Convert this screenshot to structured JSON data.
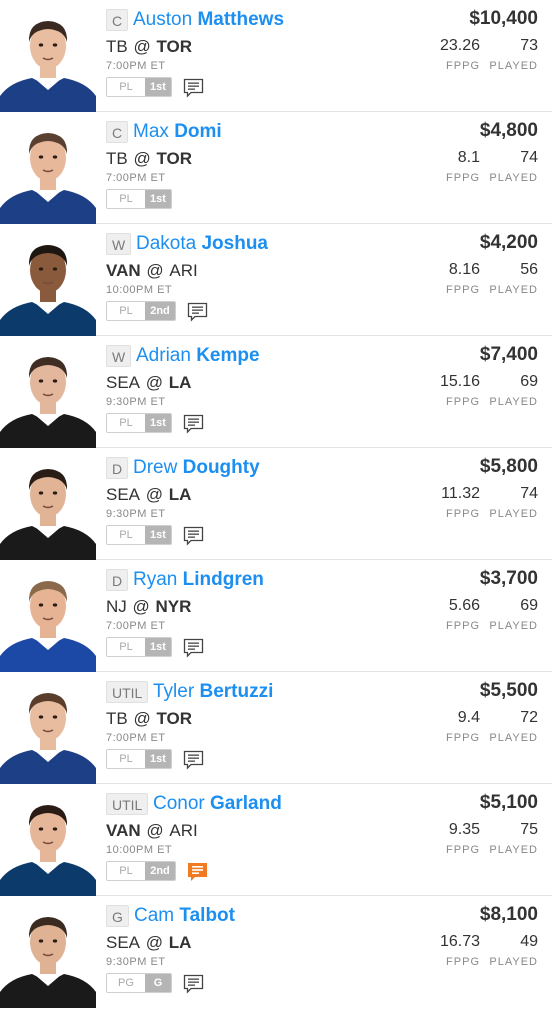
{
  "stat_labels": {
    "fppg": "FPPG",
    "played": "PLAYED"
  },
  "colors": {
    "accent": "#1c8ff0",
    "news_alert": "#f27b21"
  },
  "players": [
    {
      "position": "C",
      "first": "Auston",
      "last": "Matthews",
      "away": "TB",
      "home": "TOR",
      "bold_team": "home",
      "time": "7:00PM ET",
      "status_a": "PL",
      "status_b": "1st",
      "salary": "$10,400",
      "fppg": "23.26",
      "played": "73",
      "news": "normal",
      "jersey": "#1d3f86",
      "skin": "#e9bda0",
      "hair": "#3b2a22"
    },
    {
      "position": "C",
      "first": "Max",
      "last": "Domi",
      "away": "TB",
      "home": "TOR",
      "bold_team": "home",
      "time": "7:00PM ET",
      "status_a": "PL",
      "status_b": "1st",
      "salary": "$4,800",
      "fppg": "8.1",
      "played": "74",
      "news": "none",
      "jersey": "#1d3f86",
      "skin": "#e8b89b",
      "hair": "#5a4030"
    },
    {
      "position": "W",
      "first": "Dakota",
      "last": "Joshua",
      "away": "VAN",
      "home": "ARI",
      "bold_team": "away",
      "time": "10:00PM ET",
      "status_a": "PL",
      "status_b": "2nd",
      "salary": "$4,200",
      "fppg": "8.16",
      "played": "56",
      "news": "normal",
      "jersey": "#0b3a6b",
      "skin": "#8a5a3c",
      "hair": "#1e1611"
    },
    {
      "position": "W",
      "first": "Adrian",
      "last": "Kempe",
      "away": "SEA",
      "home": "LA",
      "bold_team": "home",
      "time": "9:30PM ET",
      "status_a": "PL",
      "status_b": "1st",
      "salary": "$7,400",
      "fppg": "15.16",
      "played": "69",
      "news": "normal",
      "jersey": "#1a1a1a",
      "skin": "#e3b79c",
      "hair": "#3f2c22"
    },
    {
      "position": "D",
      "first": "Drew",
      "last": "Doughty",
      "away": "SEA",
      "home": "LA",
      "bold_team": "home",
      "time": "9:30PM ET",
      "status_a": "PL",
      "status_b": "1st",
      "salary": "$5,800",
      "fppg": "11.32",
      "played": "74",
      "news": "normal",
      "jersey": "#1a1a1a",
      "skin": "#e2b496",
      "hair": "#2a1d16"
    },
    {
      "position": "D",
      "first": "Ryan",
      "last": "Lindgren",
      "away": "NJ",
      "home": "NYR",
      "bold_team": "home",
      "time": "7:00PM ET",
      "status_a": "PL",
      "status_b": "1st",
      "salary": "$3,700",
      "fppg": "5.66",
      "played": "69",
      "news": "normal",
      "jersey": "#1c48a6",
      "skin": "#e6b395",
      "hair": "#8a6a4a"
    },
    {
      "position": "UTIL",
      "first": "Tyler",
      "last": "Bertuzzi",
      "away": "TB",
      "home": "TOR",
      "bold_team": "home",
      "time": "7:00PM ET",
      "status_a": "PL",
      "status_b": "1st",
      "salary": "$5,500",
      "fppg": "9.4",
      "played": "72",
      "news": "normal",
      "jersey": "#1d3f86",
      "skin": "#e8bc9f",
      "hair": "#5a3e2b"
    },
    {
      "position": "UTIL",
      "first": "Conor",
      "last": "Garland",
      "away": "VAN",
      "home": "ARI",
      "bold_team": "away",
      "time": "10:00PM ET",
      "status_a": "PL",
      "status_b": "2nd",
      "salary": "$5,100",
      "fppg": "9.35",
      "played": "75",
      "news": "alert",
      "jersey": "#0b3a6b",
      "skin": "#e6b699",
      "hair": "#2a1c14"
    },
    {
      "position": "G",
      "first": "Cam",
      "last": "Talbot",
      "away": "SEA",
      "home": "LA",
      "bold_team": "home",
      "time": "9:30PM ET",
      "status_a": "PG",
      "status_b": "G",
      "salary": "$8,100",
      "fppg": "16.73",
      "played": "49",
      "news": "normal",
      "jersey": "#1a1a1a",
      "skin": "#e0b294",
      "hair": "#3a2a20"
    }
  ]
}
